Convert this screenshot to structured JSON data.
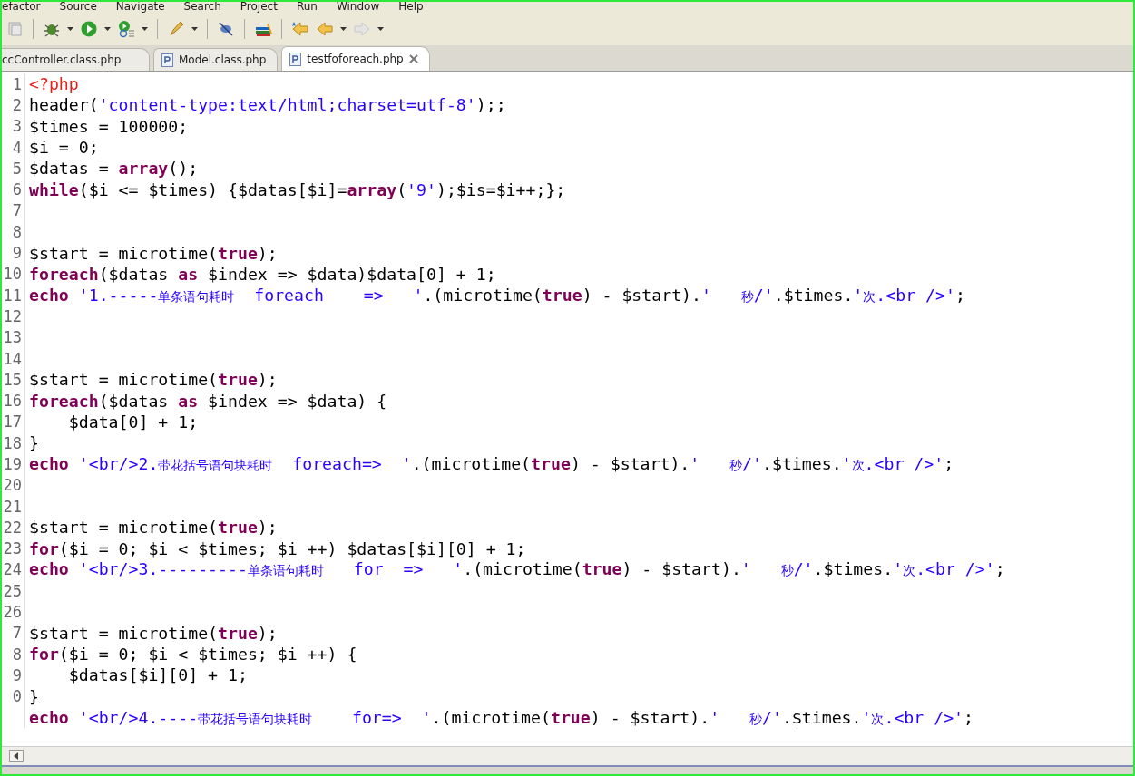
{
  "menu": [
    "efactor",
    "Source",
    "Navigate",
    "Search",
    "Project",
    "Run",
    "Window",
    "Help"
  ],
  "tabs": [
    {
      "label": "ccController.class.php",
      "selected": false,
      "file_icon": false
    },
    {
      "label": "Model.class.php",
      "selected": false,
      "file_icon": true
    },
    {
      "label": "testfoforeach.php",
      "selected": true,
      "file_icon": true
    }
  ],
  "editor": {
    "lines": [
      {
        "number": "1",
        "tokens": [
          {
            "kind": "tag",
            "text": "<?php"
          }
        ]
      },
      {
        "number": "2",
        "tokens": [
          {
            "kind": "plain",
            "text": "header("
          },
          {
            "kind": "string",
            "text": "'content-type:text/html;charset=utf-8'"
          },
          {
            "kind": "plain",
            "text": ");;"
          }
        ]
      },
      {
        "number": "3",
        "tokens": [
          {
            "kind": "plain",
            "text": "$times = 100000;"
          }
        ]
      },
      {
        "number": "4",
        "tokens": [
          {
            "kind": "plain",
            "text": "$i = 0;"
          }
        ]
      },
      {
        "number": "5",
        "tokens": [
          {
            "kind": "plain",
            "text": "$datas = "
          },
          {
            "kind": "keyword",
            "text": "array"
          },
          {
            "kind": "plain",
            "text": "();"
          }
        ]
      },
      {
        "number": "6",
        "tokens": [
          {
            "kind": "keyword",
            "text": "while"
          },
          {
            "kind": "plain",
            "text": "($i <= $times) {$datas[$i]="
          },
          {
            "kind": "keyword",
            "text": "array"
          },
          {
            "kind": "plain",
            "text": "("
          },
          {
            "kind": "string",
            "text": "'9'"
          },
          {
            "kind": "plain",
            "text": ");$is=$i++;};"
          }
        ]
      },
      {
        "number": "7"
      },
      {
        "number": "8"
      },
      {
        "number": "9",
        "tokens": [
          {
            "kind": "plain",
            "text": "$start = microtime("
          },
          {
            "kind": "keyword",
            "text": "true"
          },
          {
            "kind": "plain",
            "text": ");"
          }
        ]
      },
      {
        "number": "10",
        "tokens": [
          {
            "kind": "keyword",
            "text": "foreach"
          },
          {
            "kind": "plain",
            "text": "($datas "
          },
          {
            "kind": "keyword",
            "text": "as"
          },
          {
            "kind": "plain",
            "text": " $index => $data)$data[0] + 1;"
          }
        ]
      },
      {
        "number": "11",
        "tokens": [
          {
            "kind": "keyword",
            "text": "echo "
          },
          {
            "kind": "string",
            "text": "'1.-----单条语句耗时  foreach    =>   '"
          },
          {
            "kind": "plain",
            "text": ".(microtime("
          },
          {
            "kind": "keyword",
            "text": "true"
          },
          {
            "kind": "plain",
            "text": ") - $start)."
          },
          {
            "kind": "string",
            "text": "'   秒/'"
          },
          {
            "kind": "plain",
            "text": ".$times."
          },
          {
            "kind": "string",
            "text": "'次.<br />'"
          },
          {
            "kind": "plain",
            "text": ";"
          }
        ]
      },
      {
        "number": "12"
      },
      {
        "number": "13"
      },
      {
        "number": "14"
      },
      {
        "number": "15",
        "tokens": [
          {
            "kind": "plain",
            "text": "$start = microtime("
          },
          {
            "kind": "keyword",
            "text": "true"
          },
          {
            "kind": "plain",
            "text": ");"
          }
        ]
      },
      {
        "number": "16",
        "tokens": [
          {
            "kind": "keyword",
            "text": "foreach"
          },
          {
            "kind": "plain",
            "text": "($datas "
          },
          {
            "kind": "keyword",
            "text": "as"
          },
          {
            "kind": "plain",
            "text": " $index => $data) {"
          }
        ]
      },
      {
        "number": "17",
        "tokens": [
          {
            "kind": "plain",
            "text": "    $data[0] + 1;"
          }
        ]
      },
      {
        "number": "18",
        "tokens": [
          {
            "kind": "plain",
            "text": "}"
          }
        ]
      },
      {
        "number": "19",
        "tokens": [
          {
            "kind": "keyword",
            "text": "echo "
          },
          {
            "kind": "string",
            "text": "'<br/>2.带花括号语句块耗时  foreach=>  '"
          },
          {
            "kind": "plain",
            "text": ".(microtime("
          },
          {
            "kind": "keyword",
            "text": "true"
          },
          {
            "kind": "plain",
            "text": ") - $start)."
          },
          {
            "kind": "string",
            "text": "'   秒/'"
          },
          {
            "kind": "plain",
            "text": ".$times."
          },
          {
            "kind": "string",
            "text": "'次.<br />'"
          },
          {
            "kind": "plain",
            "text": ";"
          }
        ]
      },
      {
        "number": "20"
      },
      {
        "number": "21"
      },
      {
        "number": "22",
        "tokens": [
          {
            "kind": "plain",
            "text": "$start = microtime("
          },
          {
            "kind": "keyword",
            "text": "true"
          },
          {
            "kind": "plain",
            "text": ");"
          }
        ]
      },
      {
        "number": "23",
        "tokens": [
          {
            "kind": "keyword",
            "text": "for"
          },
          {
            "kind": "plain",
            "text": "($i = 0; $i < $times; $i ++) $datas[$i][0] + 1;"
          }
        ]
      },
      {
        "number": "24",
        "tokens": [
          {
            "kind": "keyword",
            "text": "echo "
          },
          {
            "kind": "string",
            "text": "'<br/>3.---------单条语句耗时   for  =>   '"
          },
          {
            "kind": "plain",
            "text": ".(microtime("
          },
          {
            "kind": "keyword",
            "text": "true"
          },
          {
            "kind": "plain",
            "text": ") - $start)."
          },
          {
            "kind": "string",
            "text": "'   秒/'"
          },
          {
            "kind": "plain",
            "text": ".$times."
          },
          {
            "kind": "string",
            "text": "'次.<br />'"
          },
          {
            "kind": "plain",
            "text": ";"
          }
        ]
      },
      {
        "number": "25"
      },
      {
        "number": "26"
      },
      {
        "number": "7",
        "tokens": [
          {
            "kind": "plain",
            "text": "$start = microtime("
          },
          {
            "kind": "keyword",
            "text": "true"
          },
          {
            "kind": "plain",
            "text": ");"
          }
        ]
      },
      {
        "number": "8",
        "tokens": [
          {
            "kind": "keyword",
            "text": "for"
          },
          {
            "kind": "plain",
            "text": "($i = 0; $i < $times; $i ++) {"
          }
        ]
      },
      {
        "number": "9",
        "tokens": [
          {
            "kind": "plain",
            "text": "    $datas[$i][0] + 1;"
          }
        ]
      },
      {
        "number": "0",
        "tokens": [
          {
            "kind": "plain",
            "text": "}"
          }
        ]
      },
      {
        "tokens": [
          {
            "kind": "keyword",
            "text": "echo "
          },
          {
            "kind": "string",
            "text": "'<br/>4.----带花括号语句块耗时    for=>  '"
          },
          {
            "kind": "plain",
            "text": ".(microtime("
          },
          {
            "kind": "keyword",
            "text": "true"
          },
          {
            "kind": "plain",
            "text": ") - $start)."
          },
          {
            "kind": "string",
            "text": "'   秒/'"
          },
          {
            "kind": "plain",
            "text": ".$times."
          },
          {
            "kind": "string",
            "text": "'次.<br />'"
          },
          {
            "kind": "plain",
            "text": ";"
          }
        ]
      }
    ]
  }
}
